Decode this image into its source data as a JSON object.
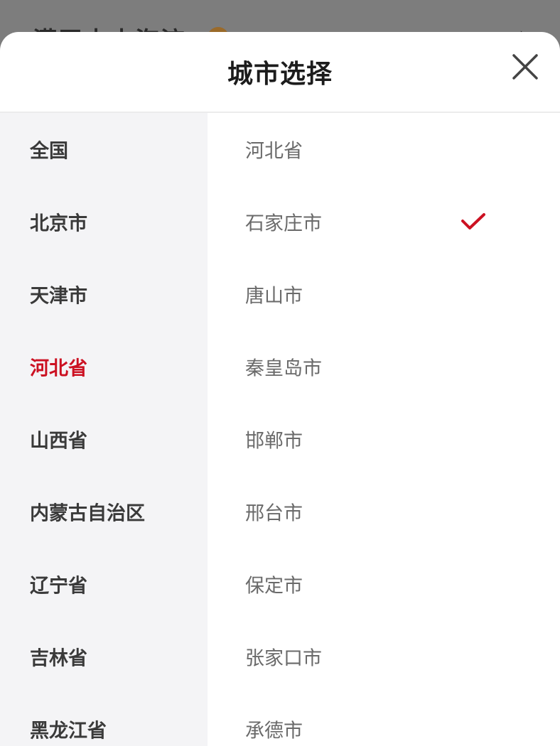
{
  "backdrop": {
    "title": "灌平十十海流"
  },
  "sheet": {
    "title": "城市选择",
    "close_icon": "close-icon"
  },
  "provinces": [
    {
      "label": "全国",
      "active": false
    },
    {
      "label": "北京市",
      "active": false
    },
    {
      "label": "天津市",
      "active": false
    },
    {
      "label": "河北省",
      "active": true
    },
    {
      "label": "山西省",
      "active": false
    },
    {
      "label": "内蒙古自治区",
      "active": false
    },
    {
      "label": "辽宁省",
      "active": false
    },
    {
      "label": "吉林省",
      "active": false
    },
    {
      "label": "黑龙江省",
      "active": false
    }
  ],
  "cities": [
    {
      "label": "河北省",
      "selected": false
    },
    {
      "label": "石家庄市",
      "selected": true
    },
    {
      "label": "唐山市",
      "selected": false
    },
    {
      "label": "秦皇岛市",
      "selected": false
    },
    {
      "label": "邯郸市",
      "selected": false
    },
    {
      "label": "邢台市",
      "selected": false
    },
    {
      "label": "保定市",
      "selected": false
    },
    {
      "label": "张家口市",
      "selected": false
    },
    {
      "label": "承德市",
      "selected": false
    }
  ],
  "colors": {
    "accent": "#cc1122",
    "province_bg": "#f4f4f6",
    "city_text": "#6a6a6a"
  }
}
